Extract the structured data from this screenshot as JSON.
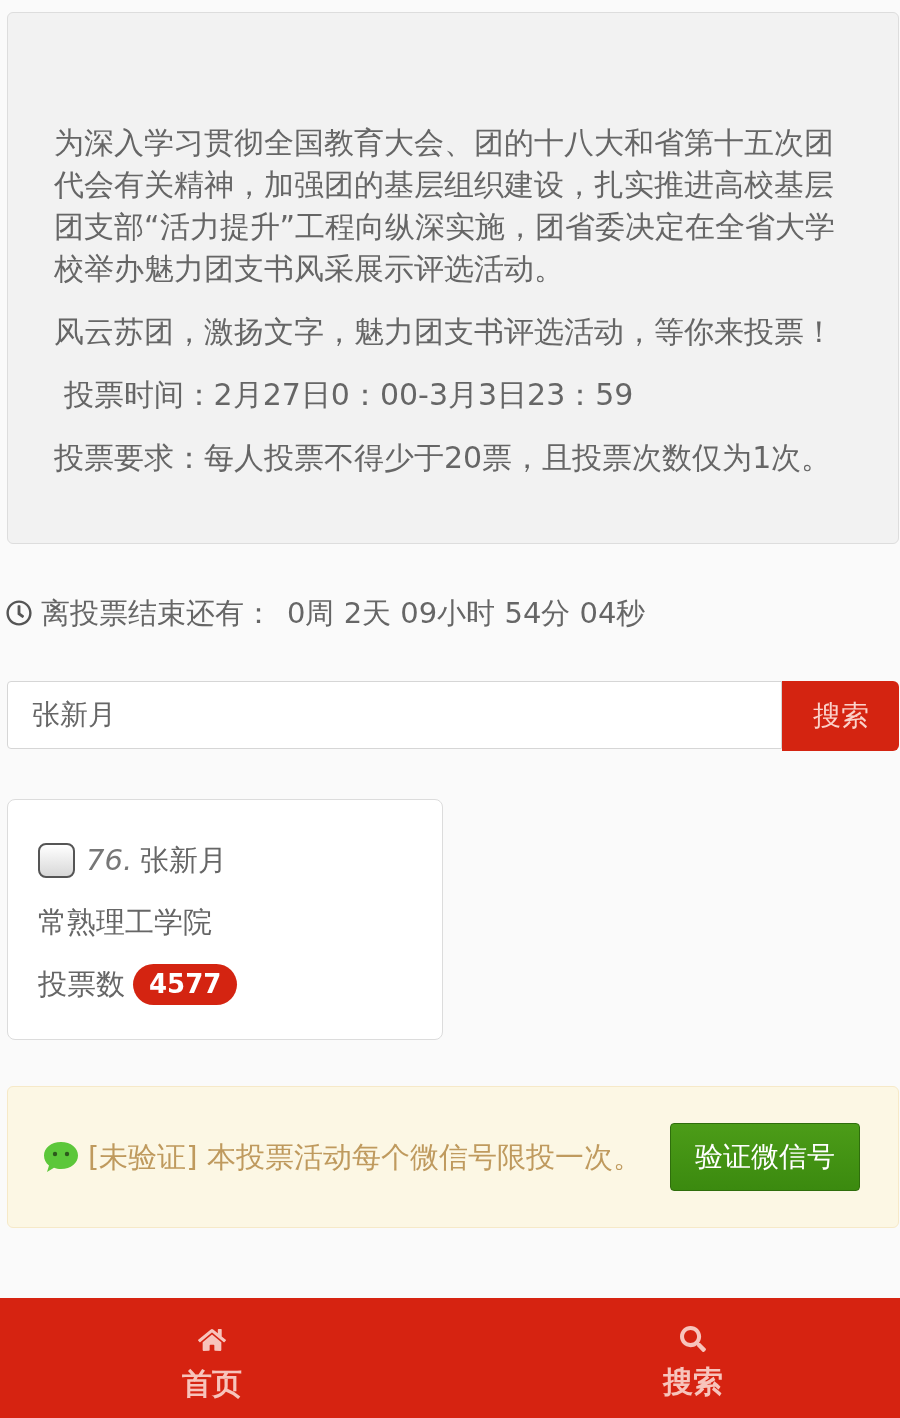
{
  "intro": {
    "paragraphs": [
      "为深入学习贯彻全国教育大会、团的十八大和省第十五次团代会有关精神，加强团的基层组织建设，扎实推进高校基层团支部“活力提升”工程向纵深实施，团省委决定在全省大学校举办魅力团支书风采展示评选活动。",
      "风云苏团，激扬文字，魅力团支书评选活动，等你来投票！",
      " 投票时间：2月27日0：00-3月3日23：59",
      "投票要求：每人投票不得少于20票，且投票次数仅为1次。"
    ]
  },
  "countdown": {
    "label": "离投票结束还有：",
    "value": "0周 2天 09小时 54分 04秒"
  },
  "search": {
    "value": "张新月",
    "button": "搜索"
  },
  "candidates": [
    {
      "number": "76.",
      "name": "张新月",
      "checked": false,
      "school": "常熟理工学院",
      "votes_label": "投票数",
      "votes": "4577"
    }
  ],
  "notice": {
    "text": "[未验证] 本投票活动每个微信号限投一次。",
    "button": "验证微信号"
  },
  "bottom_nav": [
    {
      "kind": "home",
      "label": "首页"
    },
    {
      "kind": "search",
      "label": "搜索"
    }
  ]
}
